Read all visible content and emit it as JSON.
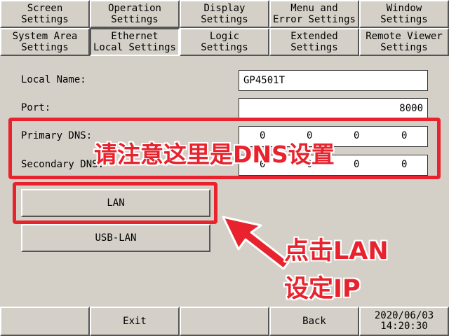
{
  "tabs_row1": [
    "Screen\nSettings",
    "Operation\nSettings",
    "Display\nSettings",
    "Menu and\nError Settings",
    "Window\nSettings"
  ],
  "tabs_row2": [
    "System Area\nSettings",
    "Ethernet\nLocal Settings",
    "Logic\nSettings",
    "Extended\nSettings",
    "Remote Viewer\nSettings"
  ],
  "form": {
    "local_name_label": "Local Name:",
    "local_name_value": "GP4501T",
    "port_label": "Port:",
    "port_value": "8000",
    "primary_dns_label": "Primary DNS:",
    "primary_dns": [
      "0",
      "0",
      "0",
      "0"
    ],
    "secondary_dns_label": "Secondary DNS:",
    "secondary_dns": [
      "0",
      "0",
      "0",
      "0"
    ]
  },
  "buttons": {
    "lan": "LAN",
    "usb_lan": "USB-LAN"
  },
  "annotations": {
    "dns_note": "请注意这里是DNS设置",
    "click_lan_line1": "点击LAN",
    "click_lan_line2": "设定IP",
    "accent_color": "#e8232e"
  },
  "bottom": {
    "exit": "Exit",
    "back": "Back",
    "date": "2020/06/03",
    "time": "14:20:30"
  }
}
